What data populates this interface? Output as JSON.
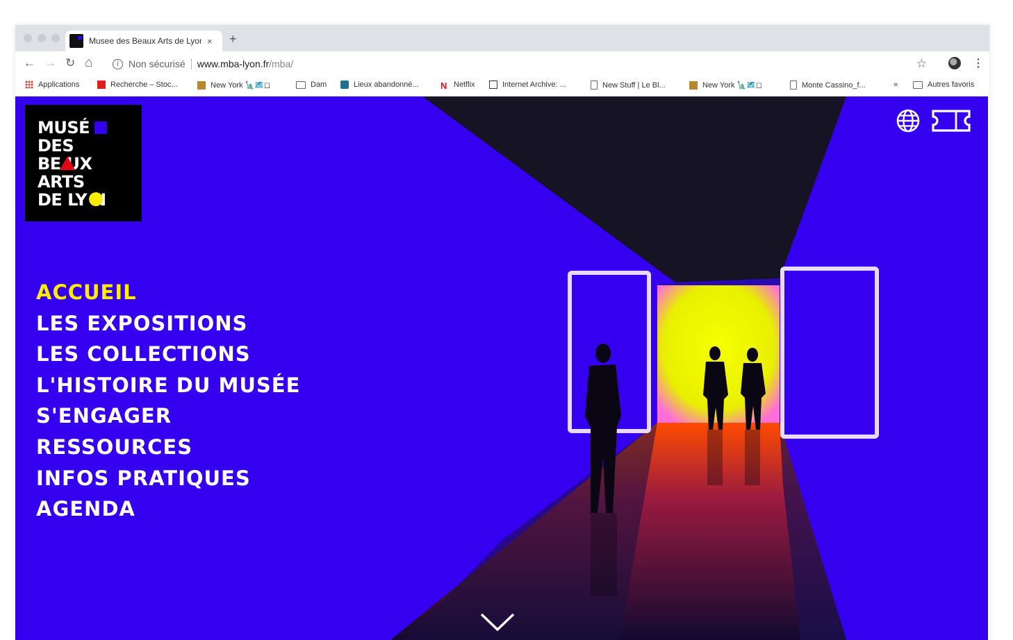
{
  "browser": {
    "tab": {
      "title": "Musee des Beaux Arts de Lyon",
      "close": "×"
    },
    "new_tab": "+",
    "toolbar": {
      "back": "←",
      "forward": "→",
      "reload": "↻",
      "home": "⌂",
      "security_label": "Non sécurisé",
      "url_host": "www.mba-lyon.fr",
      "url_path": "/mba/",
      "star": "☆",
      "menu": "⋮"
    },
    "bookmarks": [
      {
        "label": "Applications",
        "icon": "apps-icon"
      },
      {
        "label": "Recherche – Stoc...",
        "icon": "red-favicon"
      },
      {
        "label": "New York 🗽🗺️◻",
        "icon": "gold-favicon"
      },
      {
        "label": "Dam",
        "icon": "folder-icon"
      },
      {
        "label": "Lieux abandonné...",
        "icon": "teal-favicon"
      },
      {
        "label": "Netflix",
        "icon": "netflix-icon"
      },
      {
        "label": "Internet Archive: ...",
        "icon": "archive-icon"
      },
      {
        "label": "New Stuff | Le Bl...",
        "icon": "page-icon"
      },
      {
        "label": "New York 🗽🗺️◻",
        "icon": "gold-favicon"
      },
      {
        "label": "Monte Cassino_f...",
        "icon": "page-icon"
      },
      {
        "label": "»",
        "icon": ""
      },
      {
        "label": "Autres favoris",
        "icon": "folder-icon"
      }
    ]
  },
  "site": {
    "logo_lines": [
      "MUSÉ",
      "DES",
      "BE  UX",
      "ARTS",
      "DE LY  N"
    ],
    "nav": [
      {
        "label": "ACCUEIL",
        "active": true
      },
      {
        "label": "LES EXPOSITIONS",
        "active": false
      },
      {
        "label": "LES COLLECTIONS",
        "active": false
      },
      {
        "label": "L'HISTOIRE DU MUSÉE",
        "active": false
      },
      {
        "label": "S'ENGAGER",
        "active": false
      },
      {
        "label": "RESSOURCES",
        "active": false
      },
      {
        "label": "INFOS PRATIQUES",
        "active": false
      },
      {
        "label": "AGENDA",
        "active": false
      }
    ],
    "icons": [
      "globe-icon",
      "ticket-icon",
      "chevron-down-icon"
    ],
    "colors": {
      "background": "#3500f0",
      "active_nav": "#ffed00",
      "logo_red": "#e30613",
      "logo_yellow": "#ffed00"
    }
  }
}
